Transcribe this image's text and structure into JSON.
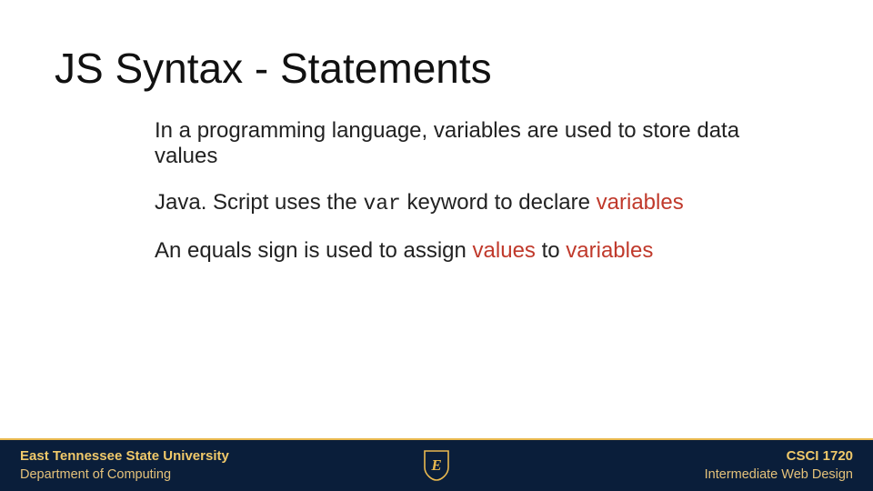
{
  "title": "JS Syntax - Statements",
  "paragraphs": {
    "p1": "In a programming language, variables are used to store data values",
    "p2": {
      "pre": "Java. Script uses the ",
      "code": "var",
      "mid": " keyword to declare ",
      "red": "variables"
    },
    "p3": {
      "pre": "An equals sign is used to assign ",
      "red1": "values",
      "mid": " to ",
      "red2": "variables"
    }
  },
  "footer": {
    "left_line1": "East Tennessee State University",
    "left_line2": "Department of Computing",
    "right_line1": "CSCI 1720",
    "right_line2": "Intermediate Web Design",
    "crest_letter": "E"
  },
  "colors": {
    "footer_bg": "#0a1e3a",
    "accent": "#e9b94f",
    "red": "#c0392b"
  }
}
